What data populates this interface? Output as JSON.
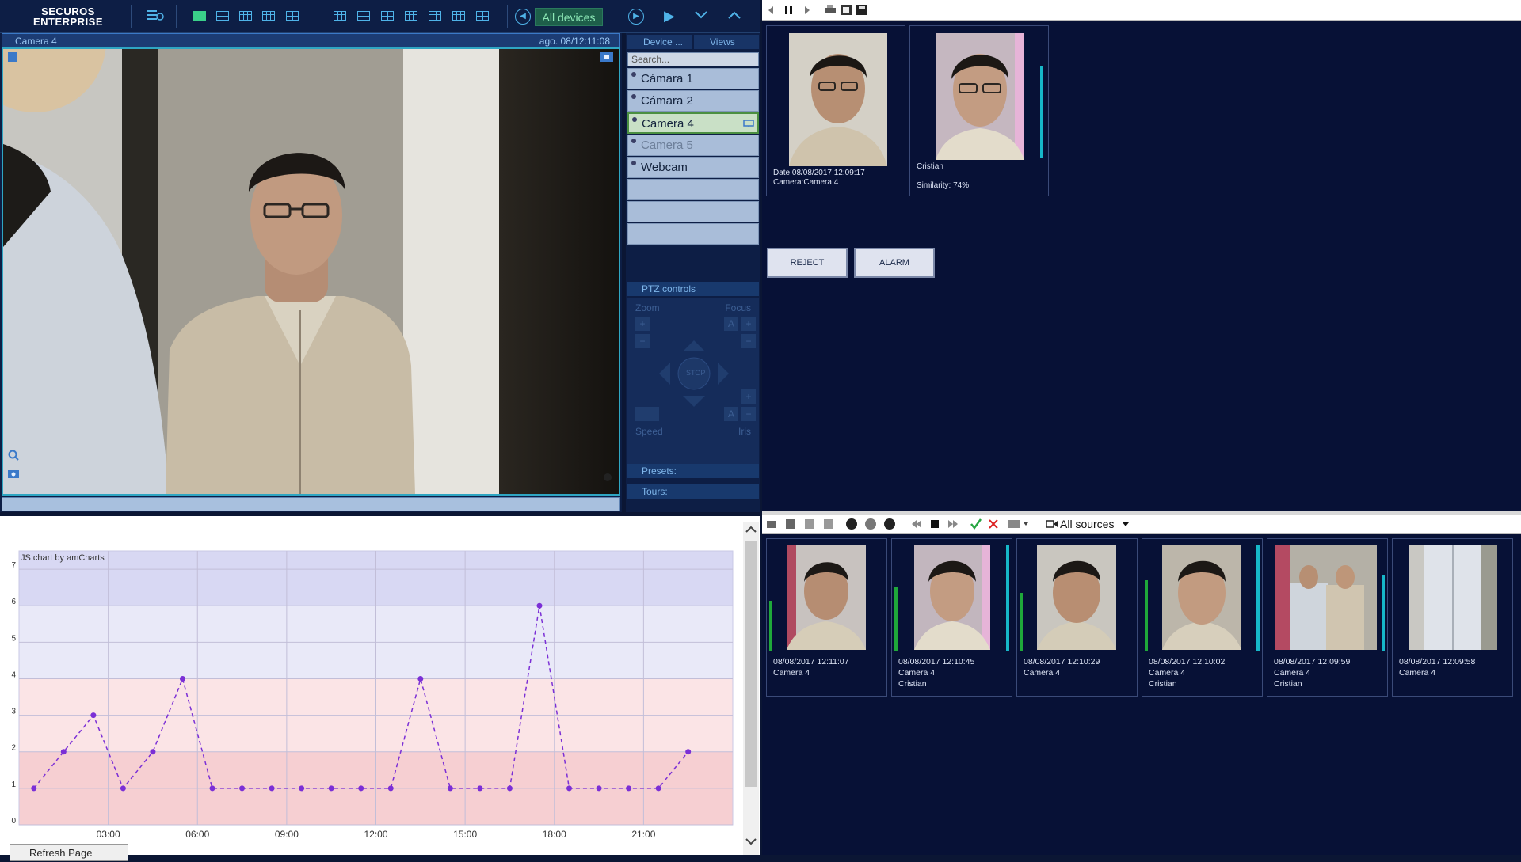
{
  "app": {
    "logo_line1": "SECUROS",
    "logo_line2": "ENTERPRISE"
  },
  "toolbar": {
    "all_devices": "All devices"
  },
  "camera_view": {
    "title": "Camera 4",
    "timestamp": "ago. 08/12:11:08"
  },
  "device_panel": {
    "tab_devices": "Device ...",
    "tab_views": "Views",
    "search_placeholder": "Search...",
    "devices": [
      "Cámara 1",
      "Cámara 2",
      "Camera 4",
      "Camera 5",
      "Webcam"
    ],
    "selected": "Camera 4"
  },
  "ptz": {
    "header": "PTZ controls",
    "zoom": "Zoom",
    "focus": "Focus",
    "speed": "Speed",
    "iris": "Iris",
    "stop": "STOP",
    "auto_focus": "A",
    "auto_iris": "A",
    "plus": "+",
    "minus": "−"
  },
  "presets": {
    "label": "Presets:"
  },
  "tours": {
    "label": "Tours:"
  },
  "chart_data": {
    "type": "line",
    "title": "JS chart by amCharts",
    "x_ticks": [
      "03:00",
      "06:00",
      "09:00",
      "12:00",
      "15:00",
      "18:00",
      "21:00"
    ],
    "x": [
      0.5,
      1.5,
      2.5,
      3.5,
      4.5,
      5.5,
      6.5,
      7.5,
      8.5,
      9.5,
      10.5,
      11.5,
      12.5,
      13.5,
      14.5,
      15.5,
      16.5,
      17.5,
      18.5,
      19.5,
      20.5,
      21.5,
      22.5
    ],
    "x_unit": "hour",
    "values": [
      1,
      2,
      3,
      1,
      2,
      4,
      1,
      1,
      1,
      1,
      1,
      1,
      1,
      4,
      1,
      1,
      1,
      6,
      1,
      1,
      1,
      1,
      2
    ],
    "y_ticks": [
      0,
      1,
      2,
      3,
      4,
      5,
      6,
      7
    ],
    "ylim": [
      0,
      7.5
    ],
    "xlim": [
      0,
      24
    ],
    "line_color": "#7b2fd6",
    "line_style": "dashed",
    "bands": [
      {
        "from": 0,
        "to": 2,
        "color": "#f6cfd2"
      },
      {
        "from": 2,
        "to": 4,
        "color": "#fbe4e6"
      },
      {
        "from": 4,
        "to": 6,
        "color": "#e9e9f8"
      },
      {
        "from": 6,
        "to": 7.5,
        "color": "#d8d8f3"
      }
    ],
    "grid": true
  },
  "refresh_button": "Refresh Page",
  "match": {
    "detected": {
      "date": "Date:08/08/2017 12:09:17",
      "camera": "Camera:Camera 4"
    },
    "reference": {
      "name": "Cristian",
      "similarity": "Similarity: 74%"
    },
    "reject_button": "REJECT",
    "alarm_button": "ALARM"
  },
  "history": {
    "source_filter": "All sources",
    "items": [
      {
        "time": "08/08/2017 12:11:07",
        "camera": "Camera 4",
        "person": ""
      },
      {
        "time": "08/08/2017 12:10:45",
        "camera": "Camera 4",
        "person": "Cristian"
      },
      {
        "time": "08/08/2017 12:10:29",
        "camera": "Camera 4",
        "person": ""
      },
      {
        "time": "08/08/2017 12:10:02",
        "camera": "Camera 4",
        "person": "Cristian"
      },
      {
        "time": "08/08/2017 12:09:59",
        "camera": "Camera 4",
        "person": "Cristian"
      },
      {
        "time": "08/08/2017 12:09:58",
        "camera": "Camera 4",
        "person": ""
      }
    ]
  },
  "colors": {
    "accent": "#4fb3e8",
    "panel_bg": "#071136",
    "green_level": "#1fa83a",
    "cyan_level": "#16b7c9"
  }
}
